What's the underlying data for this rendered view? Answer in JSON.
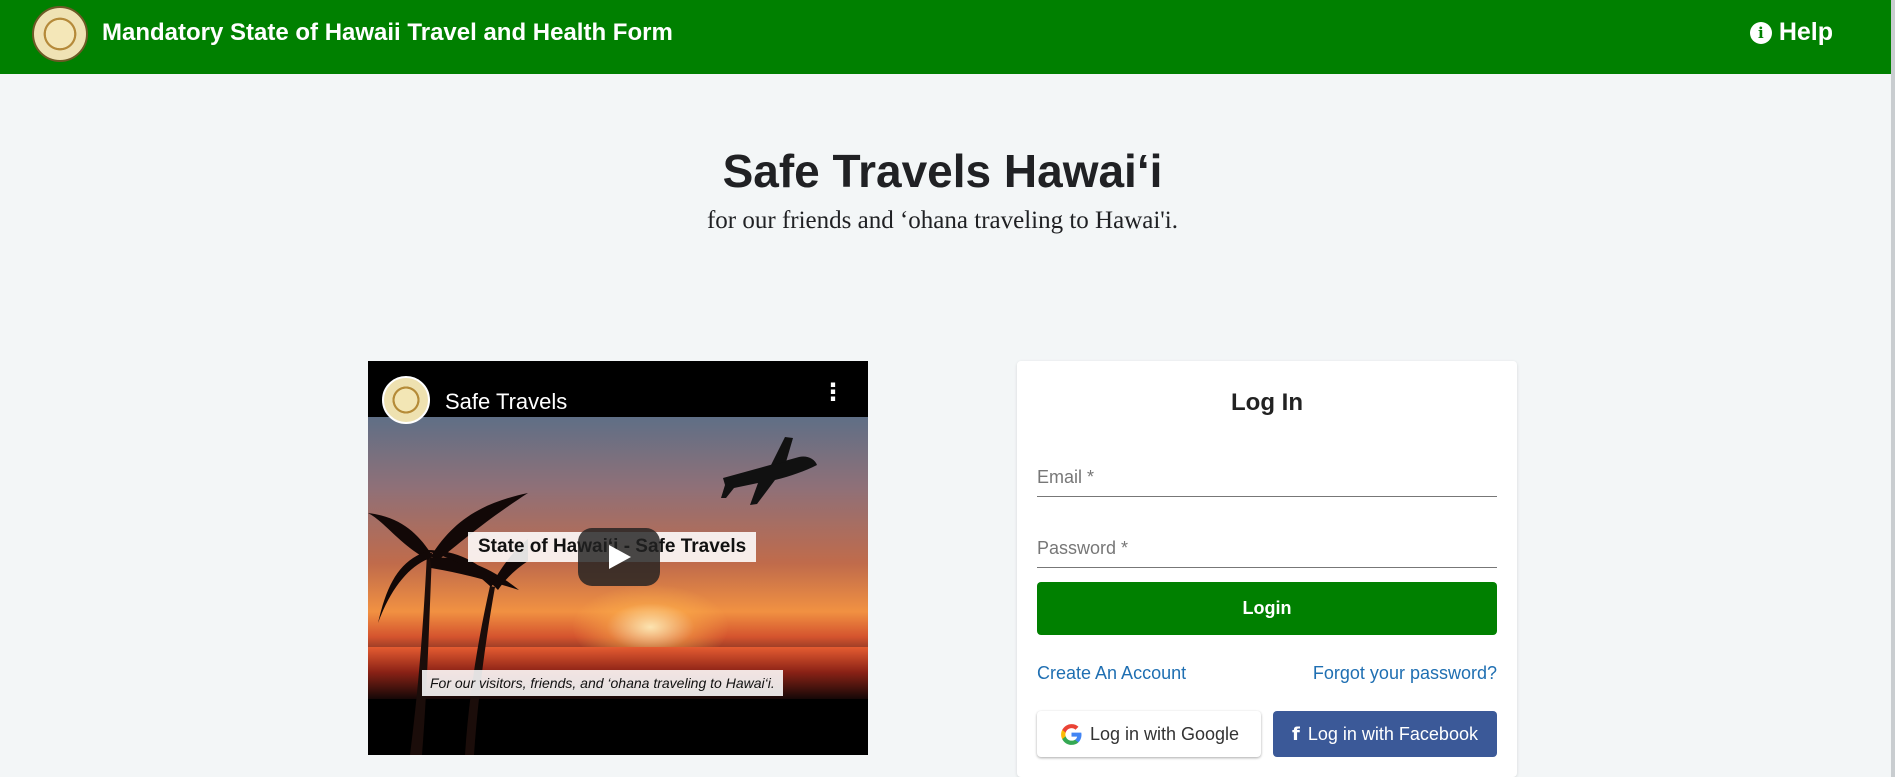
{
  "header": {
    "title": "Mandatory State of Hawaii Travel and Health Form",
    "help_label": "Help",
    "brand_color": "#008000",
    "logo_icon": "hawaii-state-seal",
    "help_icon": "info-icon"
  },
  "hero": {
    "title": "Safe Travels Hawai‘i",
    "subtitle": "for our friends and ‘ohana traveling to Hawai'i."
  },
  "video": {
    "title": "Safe Travels",
    "thumbnail_title": "State of Hawai‘i - Safe Travels",
    "thumbnail_caption": "For our visitors, friends, and ‘ohana traveling to Hawai‘i.",
    "play_icon": "play-icon",
    "menu_icon": "more-options-icon"
  },
  "login": {
    "title": "Log In",
    "email_placeholder": "Email *",
    "password_placeholder": "Password *",
    "login_label": "Login",
    "create_account_label": "Create An Account",
    "forgot_password_label": "Forgot your password?",
    "google_label": "Log in with Google",
    "facebook_label": "Log in with Facebook",
    "link_color": "#1f6fb2",
    "facebook_color": "#3b5998"
  }
}
